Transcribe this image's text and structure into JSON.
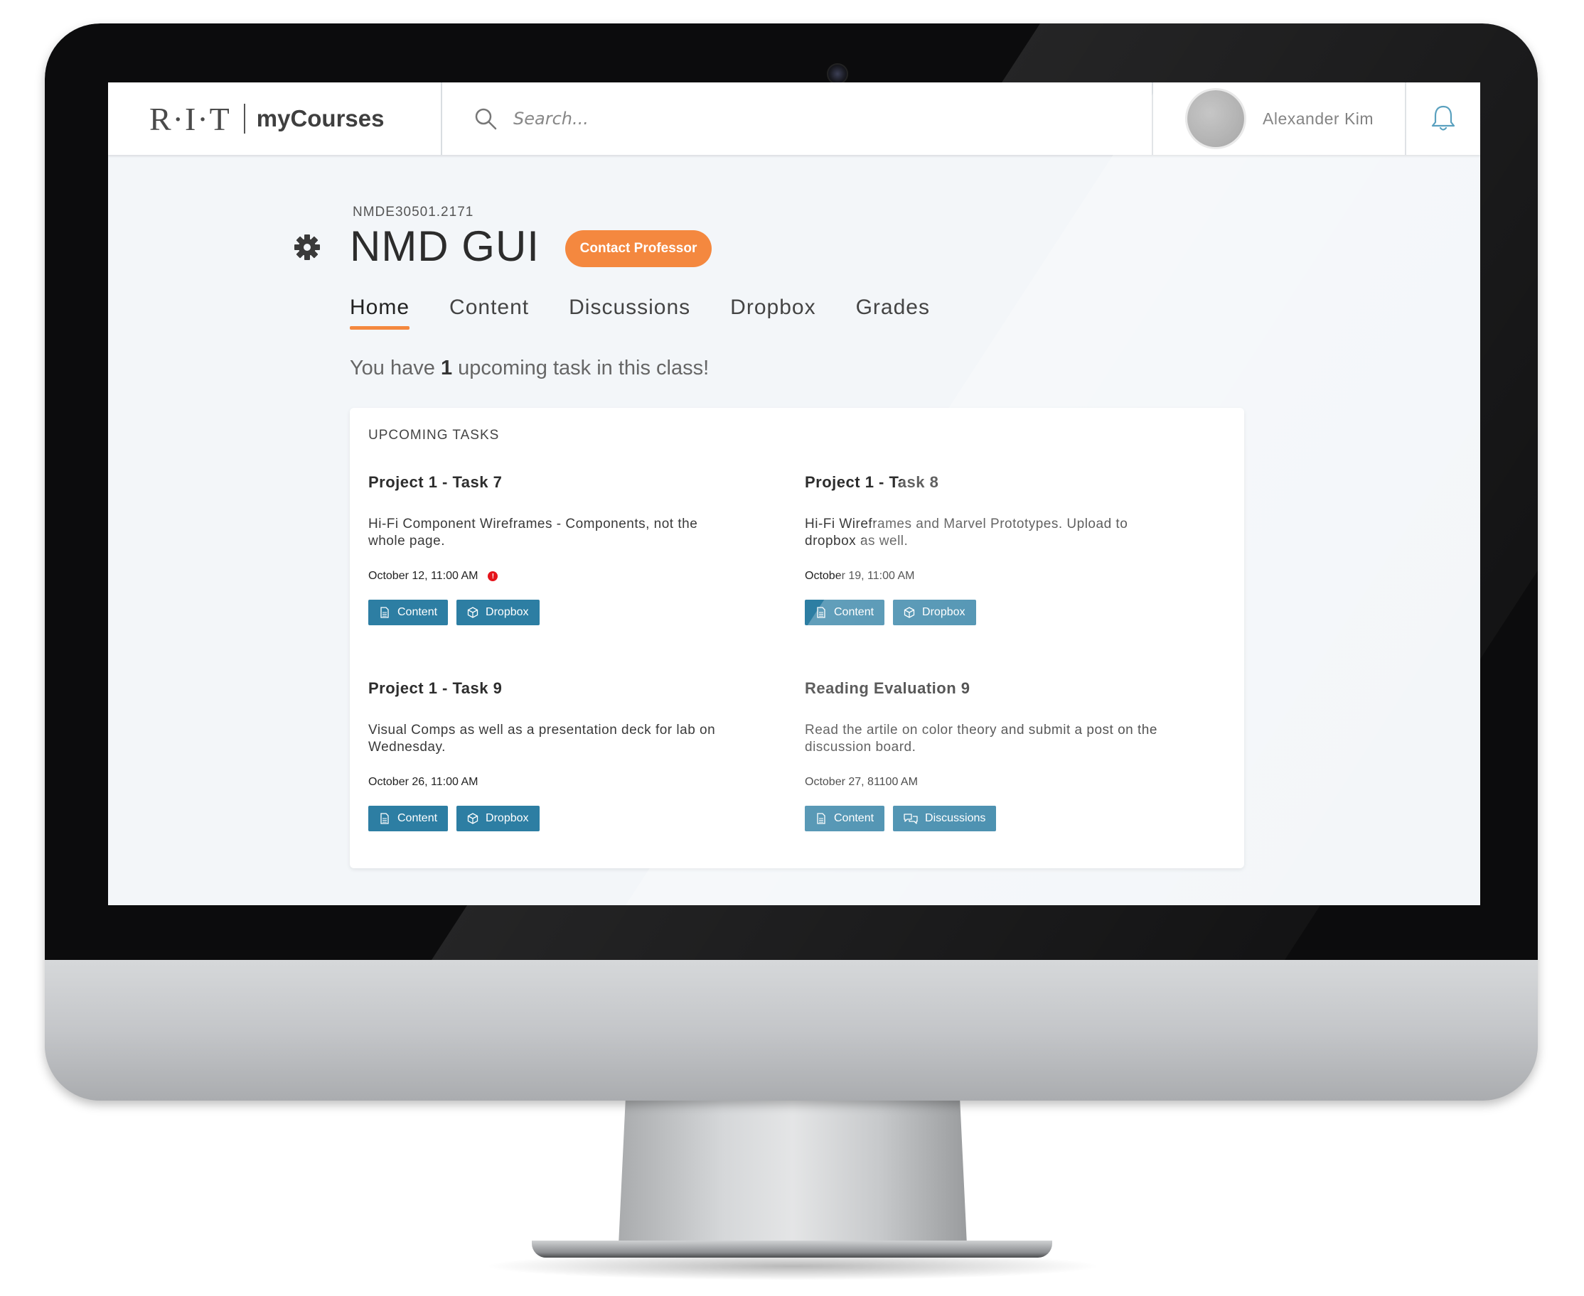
{
  "app": {
    "logo_text": "R·I·T",
    "name": "myCourses"
  },
  "search": {
    "placeholder": "Search..."
  },
  "user": {
    "name": "Alexander Kim"
  },
  "course": {
    "code": "NMDE30501.2171",
    "title": "NMD GUI",
    "contact_label": "Contact Professor"
  },
  "tabs": [
    {
      "label": "Home",
      "active": true
    },
    {
      "label": "Content",
      "active": false
    },
    {
      "label": "Discussions",
      "active": false
    },
    {
      "label": "Dropbox",
      "active": false
    },
    {
      "label": "Grades",
      "active": false
    }
  ],
  "summary": {
    "prefix": "You have",
    "count": "1",
    "suffix": "upcoming task in this class!"
  },
  "upcoming": {
    "heading": "UPCOMING TASKS",
    "tasks": [
      {
        "title": "Project 1 - Task 7",
        "description": "Hi-Fi Component Wireframes - Components, not the whole page.",
        "date": "October 12, 11:00 AM",
        "overdue_alert": true,
        "alert_glyph": "!",
        "buttons": [
          {
            "label": "Content",
            "icon": "document-icon"
          },
          {
            "label": "Dropbox",
            "icon": "box-icon"
          }
        ]
      },
      {
        "title": "Project 1 - Task 8",
        "description": "Hi-Fi Wireframes  and Marvel Prototypes. Upload to dropbox as well.",
        "date": "October 19, 11:00 AM",
        "overdue_alert": false,
        "buttons": [
          {
            "label": "Content",
            "icon": "document-icon"
          },
          {
            "label": "Dropbox",
            "icon": "box-icon"
          }
        ]
      },
      {
        "title": "Project 1 - Task 9",
        "description": "Visual Comps as well as a presentation deck for lab on Wednesday.",
        "date": "October 26, 11:00 AM",
        "overdue_alert": false,
        "buttons": [
          {
            "label": "Content",
            "icon": "document-icon"
          },
          {
            "label": "Dropbox",
            "icon": "box-icon"
          }
        ]
      },
      {
        "title": "Reading Evaluation 9",
        "description": "Read the artile on color theory and submit a post on the discussion board.",
        "date": "October 27, 81100 AM",
        "overdue_alert": false,
        "buttons": [
          {
            "label": "Content",
            "icon": "document-icon"
          },
          {
            "label": "Discussions",
            "icon": "chat-bubbles-icon"
          }
        ]
      }
    ]
  },
  "colors": {
    "accent_orange": "#f4883f",
    "button_blue": "#2d7ea3",
    "alert_red": "#e5141b",
    "screen_bg": "#f3f6f9"
  }
}
